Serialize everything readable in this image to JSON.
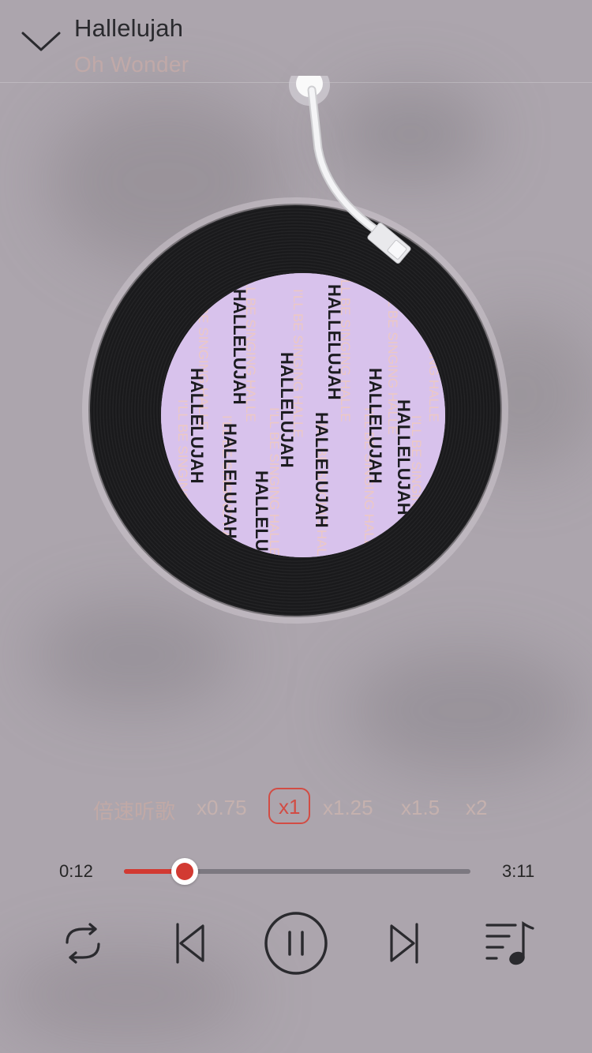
{
  "header": {
    "back_icon": "chevron-down-icon",
    "title": "Hallelujah",
    "artist": "Oh Wonder"
  },
  "album": {
    "label_text": "HALLELUJAH",
    "label_pattern_text": "I'LL BE SINGING HALLE",
    "label_color": "#d8c2ec"
  },
  "speed": {
    "label": "倍速听歌",
    "options": [
      "x0.75",
      "x1",
      "x1.25",
      "x1.5",
      "x2"
    ],
    "selected": "x1"
  },
  "progress": {
    "current": "0:12",
    "total": "3:11",
    "fraction": 0.063
  },
  "controls": {
    "repeat_icon": "repeat-icon",
    "prev_icon": "skip-previous-icon",
    "play_pause_icon": "pause-icon",
    "next_icon": "skip-next-icon",
    "playlist_icon": "playlist-icon"
  },
  "colors": {
    "accent": "#d23a32",
    "background": "#aca5ad",
    "muted_text": "#c1a9a6"
  }
}
